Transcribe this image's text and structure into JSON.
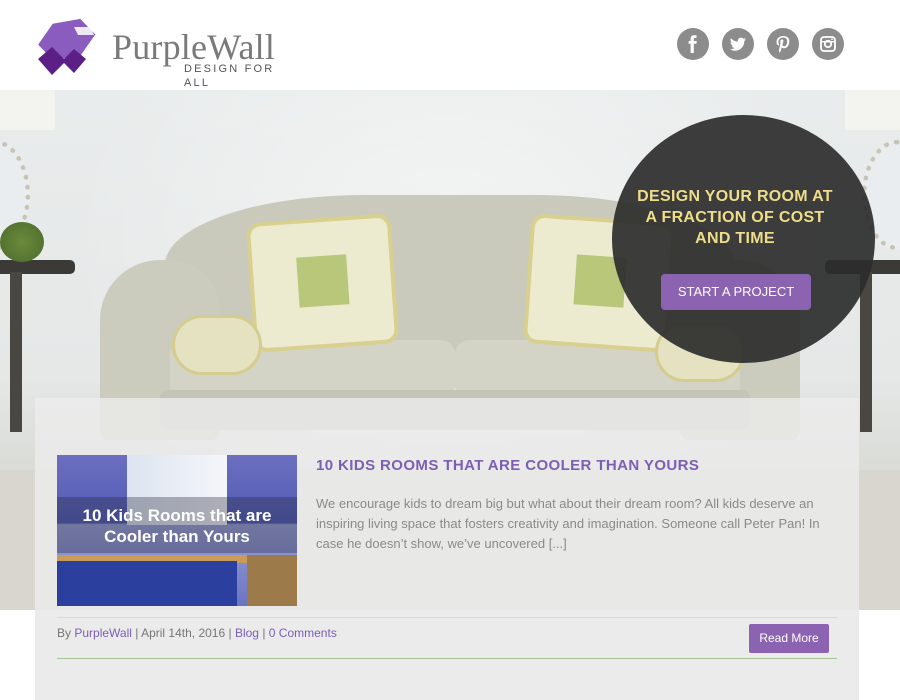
{
  "brand": {
    "name": "PurpleWall",
    "tagline": "DESIGN FOR ALL",
    "colors": {
      "purple": "#7b5fb3",
      "button": "#8c63b0",
      "gold": "#eedd8a"
    }
  },
  "social": [
    {
      "name": "facebook-icon",
      "glyph": "f"
    },
    {
      "name": "twitter-icon",
      "glyph": "t"
    },
    {
      "name": "pinterest-icon",
      "glyph": "p"
    },
    {
      "name": "instagram-icon",
      "glyph": "camera"
    }
  ],
  "hero": {
    "cta_title": "DESIGN YOUR ROOM AT A FRACTION OF COST AND TIME",
    "cta_button": "START A PROJECT"
  },
  "post": {
    "thumb_text_line1": "10 Kids Rooms that are",
    "thumb_text_line2": "Cooler than Yours",
    "title": "10 KIDS ROOMS THAT ARE COOLER THAN YOURS",
    "excerpt": "We encourage kids to dream big but what about their dream room? All kids deserve an inspiring living space that fosters creativity and imagination. Someone call Peter Pan! In case he doesn’t show, we’ve uncovered [...]",
    "meta": {
      "by_label": "By",
      "author": "PurpleWall",
      "date": "April 14th, 2016",
      "category": "Blog",
      "comments": "0 Comments",
      "separator": "|"
    },
    "read_more": "Read More"
  }
}
